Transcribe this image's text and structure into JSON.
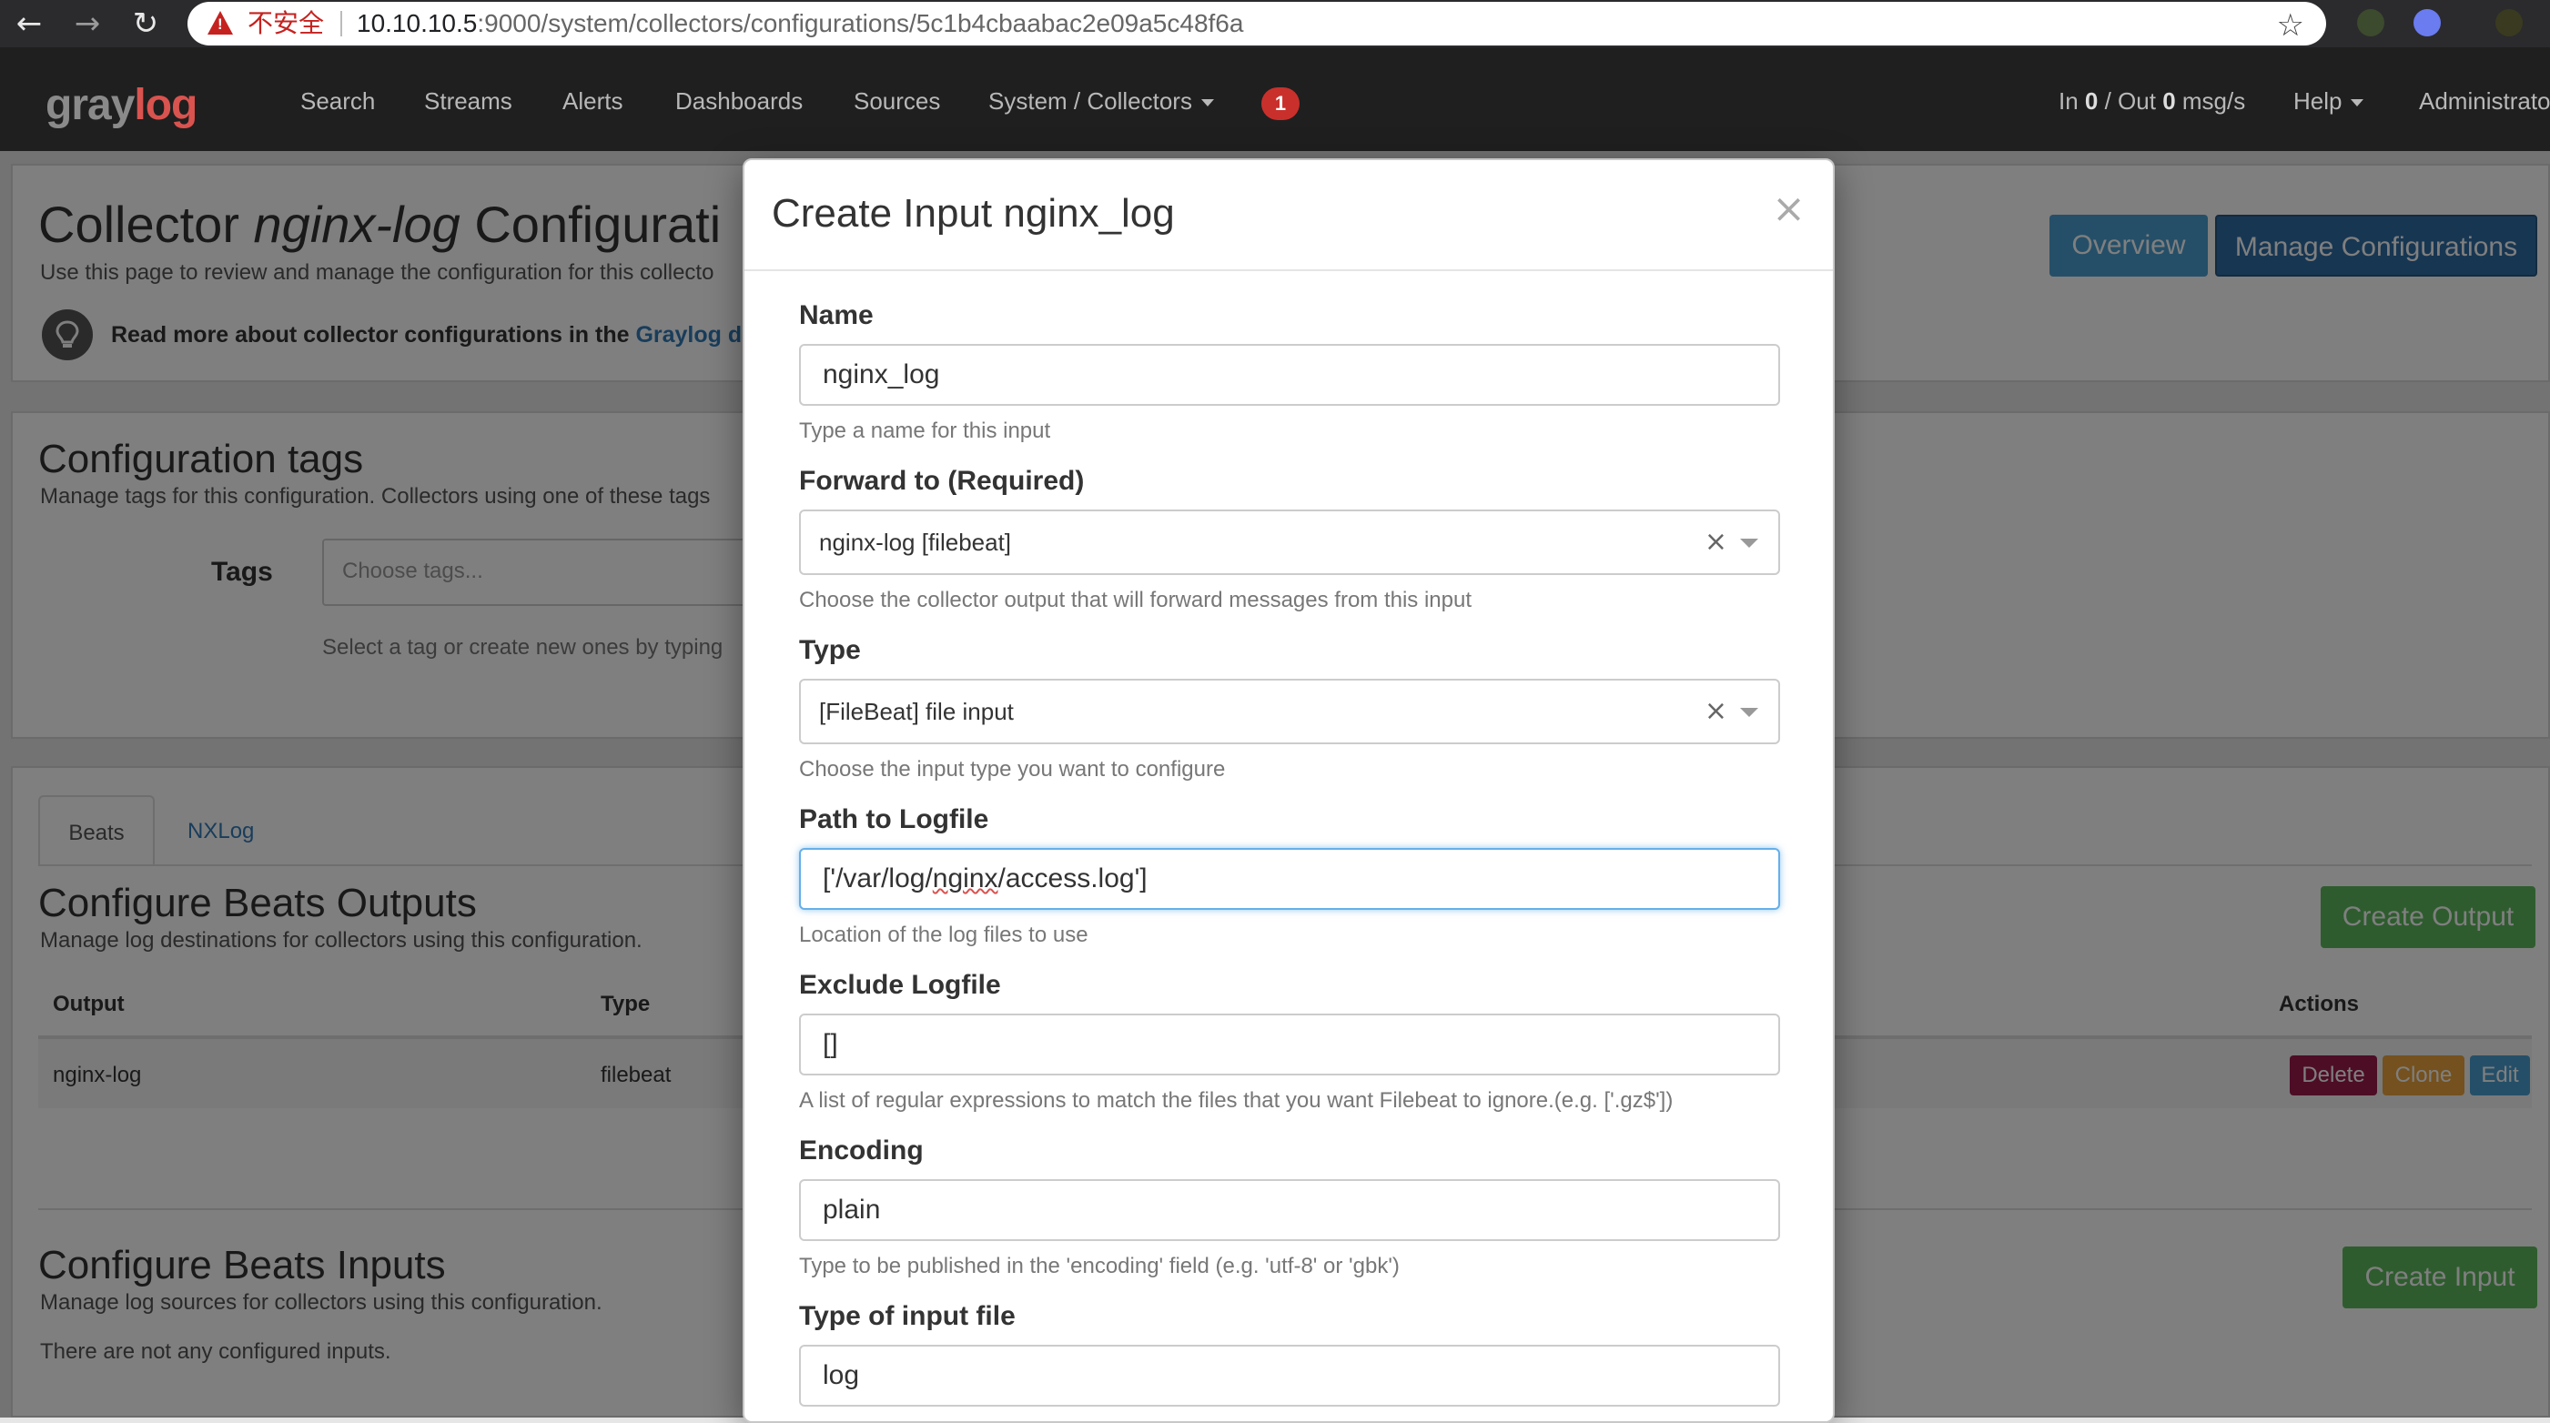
{
  "browser": {
    "insecure_label": "不安全",
    "url_host": "10.10.10.5",
    "url_rest": ":9000/system/collectors/configurations/5c1b4cbaabac2e09a5c48f6a"
  },
  "navbar": {
    "logo_prefix": "gray",
    "logo_suffix": "log",
    "items": [
      "Search",
      "Streams",
      "Alerts",
      "Dashboards",
      "Sources"
    ],
    "system_menu": "System / Collectors",
    "notifications_count": "1",
    "throughput_in_prefix": "In ",
    "throughput_in": "0",
    "throughput_out_prefix": " / Out ",
    "throughput_out": "0",
    "throughput_unit": " msg/s",
    "help": "Help",
    "user": "Administrato"
  },
  "page": {
    "title_prefix": "Collector ",
    "title_italic": "nginx-log",
    "title_suffix": " Configurati",
    "description": "Use this page to review and manage the configuration for this collecto",
    "docs_text": "Read more about collector configurations in the ",
    "docs_link": "Graylog d",
    "overview_button": "Overview",
    "manage_button": "Manage Configurations",
    "tags": {
      "heading": "Configuration tags",
      "description": "Manage tags for this configuration. Collectors using one of these tags",
      "label": "Tags",
      "placeholder": "Choose tags...",
      "help": "Select a tag or create new ones by typing"
    },
    "tabs": [
      "Beats",
      "NXLog"
    ],
    "outputs": {
      "heading": "Configure Beats Outputs",
      "description": "Manage log destinations for collectors using this configuration.",
      "create_button": "Create Output",
      "columns": {
        "output": "Output",
        "type": "Type",
        "actions": "Actions"
      },
      "rows": [
        {
          "output": "nginx-log",
          "type": "filebeat"
        }
      ],
      "actions": {
        "delete": "Delete",
        "clone": "Clone",
        "edit": "Edit"
      }
    },
    "inputs": {
      "heading": "Configure Beats Inputs",
      "description": "Manage log sources for collectors using this configuration.",
      "create_button": "Create Input",
      "empty": "There are not any configured inputs."
    }
  },
  "modal": {
    "title": "Create Input nginx_log",
    "close": "×",
    "fields": {
      "name": {
        "label": "Name",
        "value": "nginx_log",
        "help": "Type a name for this input"
      },
      "forward_to": {
        "label": "Forward to (Required)",
        "value": "nginx-log [filebeat]",
        "help": "Choose the collector output that will forward messages from this input"
      },
      "type": {
        "label": "Type",
        "value": "[FileBeat] file input",
        "help": "Choose the input type you want to configure"
      },
      "path": {
        "label": "Path to Logfile",
        "value_before": "['/var/log/",
        "value_misspelled": "nginx",
        "value_after": "/access.log']",
        "help": "Location of the log files to use"
      },
      "exclude": {
        "label": "Exclude Logfile",
        "value": "[]",
        "help": "A list of regular expressions to match the files that you want Filebeat to ignore.(e.g. ['.gz$'])"
      },
      "encoding": {
        "label": "Encoding",
        "value": "plain",
        "help": "Type to be published in the 'encoding' field (e.g. 'utf-8' or 'gbk')"
      },
      "input_type": {
        "label": "Type of input file",
        "value": "log"
      }
    }
  },
  "colors": {
    "navbar_bg": "#1f1f1f",
    "primary": "#4a9fd1",
    "success": "#5cb85c",
    "danger": "#9b1b4a",
    "warning": "#e8a33c",
    "badge": "#c9302c"
  }
}
